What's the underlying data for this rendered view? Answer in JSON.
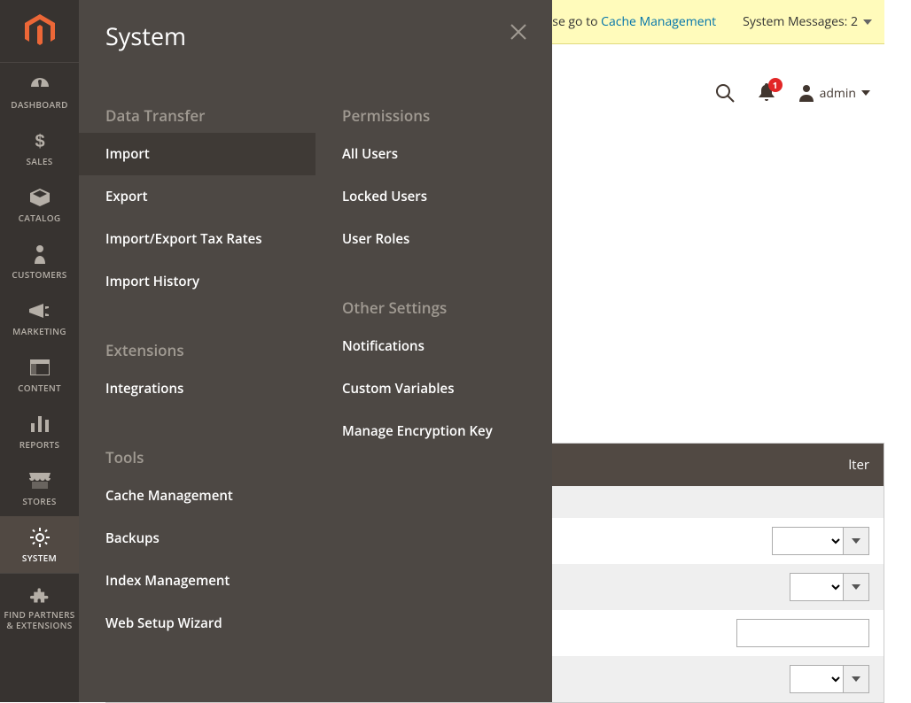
{
  "sysmsg": {
    "cache_text_suffix": "se go to ",
    "cache_link": "Cache Management",
    "messages_label": "System Messages: 2"
  },
  "header": {
    "notification_count": "1",
    "admin_label": "admin"
  },
  "sidebar": {
    "items": [
      {
        "label": "DASHBOARD"
      },
      {
        "label": "SALES"
      },
      {
        "label": "CATALOG"
      },
      {
        "label": "CUSTOMERS"
      },
      {
        "label": "MARKETING"
      },
      {
        "label": "CONTENT"
      },
      {
        "label": "REPORTS"
      },
      {
        "label": "STORES"
      },
      {
        "label": "SYSTEM"
      }
    ],
    "find_label": "FIND PARTNERS & EXTENSIONS"
  },
  "flyout": {
    "title": "System",
    "col1": [
      {
        "group": "Data Transfer",
        "items": [
          "Import",
          "Export",
          "Import/Export Tax Rates",
          "Import History"
        ],
        "active": "Import"
      },
      {
        "group": "Extensions",
        "items": [
          "Integrations"
        ]
      },
      {
        "group": "Tools",
        "items": [
          "Cache Management",
          "Backups",
          "Index Management",
          "Web Setup Wizard"
        ]
      }
    ],
    "col2": [
      {
        "group": "Permissions",
        "items": [
          "All Users",
          "Locked Users",
          "User Roles"
        ]
      },
      {
        "group": "Other Settings",
        "items": [
          "Notifications",
          "Custom Variables",
          "Manage Encryption Key"
        ]
      }
    ]
  },
  "content": {
    "filter_header_right": "lter"
  }
}
